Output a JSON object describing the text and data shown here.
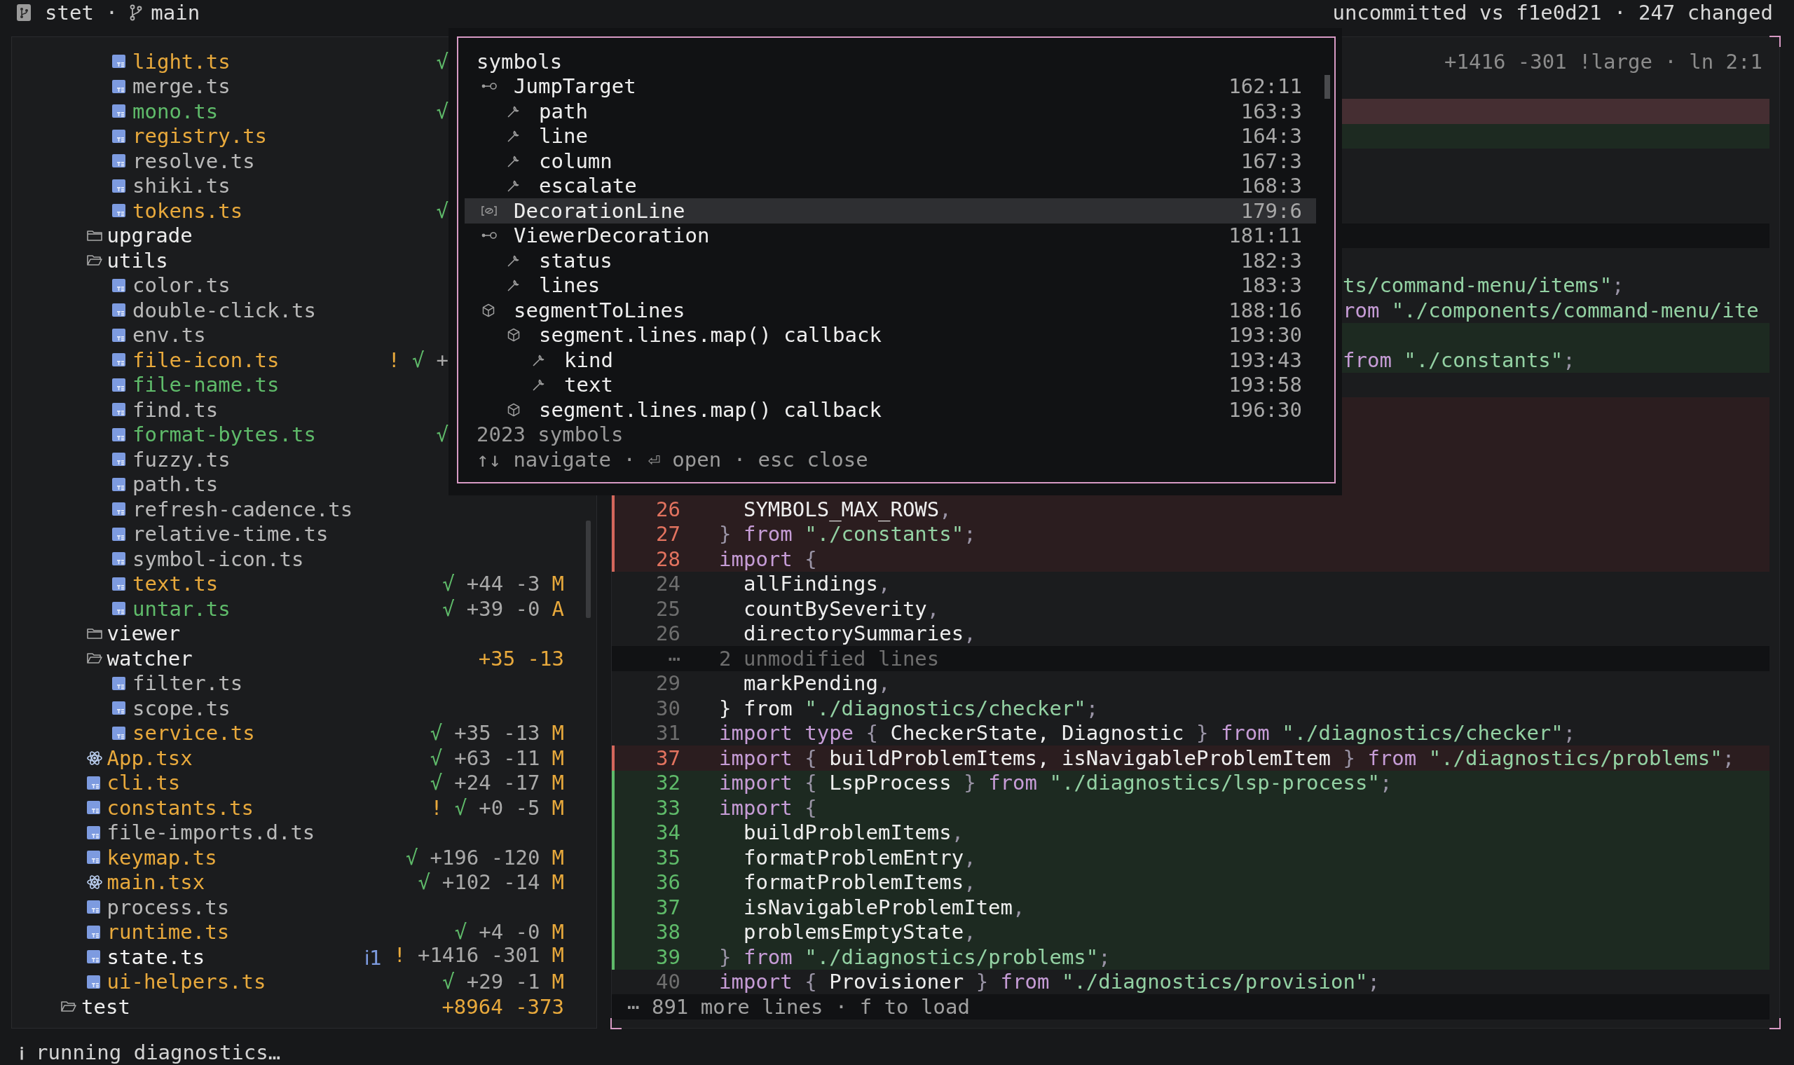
{
  "top_bar": {
    "repo": "stet",
    "separator": "·",
    "branch": "main",
    "summary": "uncommitted vs f1e0d21 · 247 changed"
  },
  "tree": {
    "items": [
      {
        "children": [
          {
            "children": [
              {
                "kind": "ts-file",
                "name": "light.ts",
                "modified": true,
                "added": false,
                "selected": false,
                "status": [
                  {
                    "kind": "ok",
                    "text": "√"
                  }
                ]
              },
              {
                "kind": "ts-file",
                "name": "merge.ts",
                "modified": false,
                "added": false,
                "selected": false
              },
              {
                "kind": "ts-file",
                "name": "mono.ts",
                "modified": false,
                "added": true,
                "selected": false,
                "status": [
                  {
                    "kind": "ok",
                    "text": "√"
                  }
                ]
              },
              {
                "kind": "ts-file",
                "name": "registry.ts",
                "modified": true,
                "added": false,
                "selected": false
              },
              {
                "kind": "ts-file",
                "name": "resolve.ts",
                "modified": false,
                "added": false,
                "selected": false
              },
              {
                "kind": "ts-file",
                "name": "shiki.ts",
                "modified": false,
                "added": false,
                "selected": false
              },
              {
                "kind": "ts-file",
                "name": "tokens.ts",
                "modified": true,
                "added": false,
                "selected": false,
                "status": [
                  {
                    "kind": "ok",
                    "text": "√"
                  }
                ]
              }
            ]
          },
          {
            "kind": "folder",
            "name": "upgrade",
            "expanded": false
          },
          {
            "kind": "folder",
            "name": "utils",
            "expanded": true,
            "children": [
              {
                "kind": "ts-file",
                "name": "color.ts",
                "modified": false,
                "added": false,
                "selected": false
              },
              {
                "kind": "ts-file",
                "name": "double-click.ts",
                "modified": false,
                "added": false,
                "selected": false
              },
              {
                "kind": "ts-file",
                "name": "env.ts",
                "modified": false,
                "added": false,
                "selected": false
              },
              {
                "kind": "ts-file",
                "name": "file-icon.ts",
                "modified": true,
                "added": false,
                "selected": false,
                "status": [
                  {
                    "kind": "warn",
                    "text": "!"
                  },
                  {
                    "kind": "ok",
                    "text": "√"
                  },
                  {
                    "kind": "stat",
                    "text": "+"
                  }
                ]
              },
              {
                "kind": "ts-file",
                "name": "file-name.ts",
                "modified": false,
                "added": true,
                "selected": false
              },
              {
                "kind": "ts-file",
                "name": "find.ts",
                "modified": false,
                "added": false,
                "selected": false
              },
              {
                "kind": "ts-file",
                "name": "format-bytes.ts",
                "modified": false,
                "added": true,
                "selected": false,
                "status": [
                  {
                    "kind": "ok",
                    "text": "√"
                  }
                ]
              },
              {
                "kind": "ts-file",
                "name": "fuzzy.ts",
                "modified": false,
                "added": false,
                "selected": false
              },
              {
                "kind": "ts-file",
                "name": "path.ts",
                "modified": false,
                "added": false,
                "selected": false
              },
              {
                "kind": "ts-file",
                "name": "refresh-cadence.ts",
                "modified": false,
                "added": false,
                "selected": false
              },
              {
                "kind": "ts-file",
                "name": "relative-time.ts",
                "modified": false,
                "added": false,
                "selected": false
              },
              {
                "kind": "ts-file",
                "name": "symbol-icon.ts",
                "modified": false,
                "added": false,
                "selected": false
              },
              {
                "kind": "ts-file",
                "name": "text.ts",
                "modified": true,
                "added": false,
                "selected": false,
                "status": [
                  {
                    "kind": "ok",
                    "text": "√"
                  },
                  {
                    "kind": "stat",
                    "text": "+44 -3"
                  },
                  {
                    "kind": "letter",
                    "text": "M"
                  }
                ]
              },
              {
                "kind": "ts-file",
                "name": "untar.ts",
                "modified": false,
                "added": true,
                "selected": false,
                "status": [
                  {
                    "kind": "ok",
                    "text": "√"
                  },
                  {
                    "kind": "stat",
                    "text": "+39 -0"
                  },
                  {
                    "kind": "letter",
                    "text": "A"
                  }
                ]
              }
            ]
          },
          {
            "kind": "folder",
            "name": "viewer",
            "expanded": false
          },
          {
            "kind": "folder",
            "name": "watcher",
            "expanded": true,
            "status": [
              {
                "kind": "total",
                "text": "+35 -13"
              }
            ],
            "children": [
              {
                "kind": "ts-file",
                "name": "filter.ts",
                "modified": false,
                "added": false,
                "selected": false
              },
              {
                "kind": "ts-file",
                "name": "scope.ts",
                "modified": false,
                "added": false,
                "selected": false
              },
              {
                "kind": "ts-file",
                "name": "service.ts",
                "modified": true,
                "added": false,
                "selected": false,
                "status": [
                  {
                    "kind": "ok",
                    "text": "√"
                  },
                  {
                    "kind": "stat",
                    "text": "+35 -13"
                  },
                  {
                    "kind": "letter",
                    "text": "M"
                  }
                ]
              }
            ]
          },
          {
            "kind": "tsx-file",
            "name": "App.tsx",
            "modified": true,
            "added": false,
            "selected": false,
            "status": [
              {
                "kind": "ok",
                "text": "√"
              },
              {
                "kind": "stat",
                "text": "+63 -11"
              },
              {
                "kind": "letter",
                "text": "M"
              }
            ]
          },
          {
            "kind": "ts-file",
            "name": "cli.ts",
            "modified": true,
            "added": false,
            "selected": false,
            "status": [
              {
                "kind": "ok",
                "text": "√"
              },
              {
                "kind": "stat",
                "text": "+24 -17"
              },
              {
                "kind": "letter",
                "text": "M"
              }
            ]
          },
          {
            "kind": "ts-file",
            "name": "constants.ts",
            "modified": true,
            "added": false,
            "selected": false,
            "status": [
              {
                "kind": "warn",
                "text": "!"
              },
              {
                "kind": "ok",
                "text": "√"
              },
              {
                "kind": "stat",
                "text": "+0 -5"
              },
              {
                "kind": "letter",
                "text": "M"
              }
            ]
          },
          {
            "kind": "ts-file",
            "name": "file-imports.d.ts",
            "modified": false,
            "added": false,
            "selected": false
          },
          {
            "kind": "ts-file",
            "name": "keymap.ts",
            "modified": true,
            "added": false,
            "selected": false,
            "status": [
              {
                "kind": "ok",
                "text": "√"
              },
              {
                "kind": "stat",
                "text": "+196 -120"
              },
              {
                "kind": "letter",
                "text": "M"
              }
            ]
          },
          {
            "kind": "tsx-file",
            "name": "main.tsx",
            "modified": true,
            "added": false,
            "selected": false,
            "status": [
              {
                "kind": "ok",
                "text": "√"
              },
              {
                "kind": "stat",
                "text": "+102 -14"
              },
              {
                "kind": "letter",
                "text": "M"
              }
            ]
          },
          {
            "kind": "ts-file",
            "name": "process.ts",
            "modified": false,
            "added": false,
            "selected": false
          },
          {
            "kind": "ts-file",
            "name": "runtime.ts",
            "modified": true,
            "added": false,
            "selected": false,
            "status": [
              {
                "kind": "ok",
                "text": "√"
              },
              {
                "kind": "stat",
                "text": "+4 -0"
              },
              {
                "kind": "letter",
                "text": "M"
              }
            ]
          },
          {
            "kind": "ts-file",
            "name": "state.ts",
            "modified": true,
            "added": false,
            "selected": true,
            "status": [
              {
                "kind": "info",
                "text": "ℹ1"
              },
              {
                "kind": "warn",
                "text": "!"
              },
              {
                "kind": "stat",
                "text": "+1416 -301"
              },
              {
                "kind": "letter",
                "text": "M"
              }
            ]
          },
          {
            "kind": "ts-file",
            "name": "ui-helpers.ts",
            "modified": true,
            "added": false,
            "selected": false,
            "status": [
              {
                "kind": "ok",
                "text": "√"
              },
              {
                "kind": "stat",
                "text": "+29 -1"
              },
              {
                "kind": "letter",
                "text": "M"
              }
            ]
          }
        ]
      },
      {
        "kind": "folder",
        "name": "test",
        "expanded": true,
        "status": [
          {
            "kind": "total",
            "text": "+8964 -373"
          }
        ]
      }
    ]
  },
  "diff": {
    "header": "+1416 -301 !large · ln 2:1",
    "rows": [
      {
        "kind": "ctx",
        "selected": false
      },
      {
        "kind": "del",
        "selected": true
      },
      {
        "kind": "add",
        "selected": false
      },
      {
        "kind": "ctx",
        "selected": false
      },
      {
        "kind": "ctx",
        "selected": false
      },
      {
        "kind": "ctx",
        "selected": false
      },
      {
        "kind": "fold",
        "selected": false
      },
      {
        "kind": "ctx",
        "selected": false
      },
      {
        "kind": "ctx",
        "selected": false,
        "tokens": [
          {
            "kind": "str",
            "text": "ts/command-menu/items\""
          },
          {
            "kind": "p",
            "text": ";"
          }
        ]
      },
      {
        "kind": "ctx",
        "selected": false,
        "tokens": [
          {
            "kind": "kw",
            "text": "rom "
          },
          {
            "kind": "str",
            "text": "\"./components/command-menu/ite"
          }
        ]
      },
      {
        "kind": "add",
        "selected": false
      },
      {
        "kind": "add",
        "selected": false,
        "tokens": [
          {
            "kind": "kw",
            "text": "from "
          },
          {
            "kind": "str",
            "text": "\"./constants\""
          },
          {
            "kind": "p",
            "text": ";"
          }
        ]
      },
      {
        "kind": "ctx",
        "selected": false
      },
      {
        "kind": "del",
        "selected": false
      },
      {
        "kind": "del",
        "selected": false
      },
      {
        "kind": "del",
        "selected": false
      },
      {
        "kind": "del",
        "selected": false
      },
      {
        "kind": "del",
        "selected": false,
        "num": "26",
        "tokens": [
          {
            "kind": "id",
            "text": "  SYMBOLS_MAX_ROWS"
          },
          {
            "kind": "p",
            "text": ","
          }
        ]
      },
      {
        "kind": "del",
        "selected": false,
        "num": "27",
        "tokens": [
          {
            "kind": "p",
            "text": "} "
          },
          {
            "kind": "kw",
            "text": "from "
          },
          {
            "kind": "str",
            "text": "\"./constants\""
          },
          {
            "kind": "p",
            "text": ";"
          }
        ]
      },
      {
        "kind": "del",
        "selected": false,
        "num": "28",
        "tokens": [
          {
            "kind": "kw",
            "text": "import"
          },
          {
            "kind": "p",
            "text": " {"
          }
        ]
      },
      {
        "kind": "ctx",
        "selected": false,
        "num": "24",
        "tokens": [
          {
            "kind": "id",
            "text": "  allFindings"
          },
          {
            "kind": "p",
            "text": ","
          }
        ]
      },
      {
        "kind": "ctx",
        "selected": false,
        "num": "25",
        "tokens": [
          {
            "kind": "id",
            "text": "  countBySeverity"
          },
          {
            "kind": "p",
            "text": ","
          }
        ]
      },
      {
        "kind": "ctx",
        "selected": false,
        "num": "26",
        "tokens": [
          {
            "kind": "id",
            "text": "  directorySummaries"
          },
          {
            "kind": "p",
            "text": ","
          }
        ]
      },
      {
        "kind": "fold",
        "selected": false,
        "num": "⋯",
        "label": "2 unmodified lines"
      },
      {
        "kind": "ctx",
        "selected": false,
        "num": "29",
        "tokens": [
          {
            "kind": "id",
            "text": "  markPending"
          },
          {
            "kind": "p",
            "text": ","
          }
        ]
      },
      {
        "kind": "ctx",
        "selected": false,
        "num": "30",
        "tokens": [
          {
            "kind": "id",
            "text": "} from "
          },
          {
            "kind": "str",
            "text": "\"./diagnostics/checker\""
          },
          {
            "kind": "p",
            "text": ";"
          }
        ]
      },
      {
        "kind": "ctx",
        "selected": false,
        "num": "31",
        "tokens": [
          {
            "kind": "kw",
            "text": "import type"
          },
          {
            "kind": "p",
            "text": " { "
          },
          {
            "kind": "id",
            "text": "CheckerState, Diagnostic"
          },
          {
            "kind": "p",
            "text": " } "
          },
          {
            "kind": "kw",
            "text": "from "
          },
          {
            "kind": "str",
            "text": "\"./diagnostics/checker\""
          },
          {
            "kind": "p",
            "text": ";"
          }
        ]
      },
      {
        "kind": "del",
        "selected": false,
        "num": "37",
        "tokens": [
          {
            "kind": "kw",
            "text": "import"
          },
          {
            "kind": "p",
            "text": " { "
          },
          {
            "kind": "id",
            "text": "buildProblemItems, isNavigableProblemItem"
          },
          {
            "kind": "p",
            "text": " } "
          },
          {
            "kind": "kw",
            "text": "from "
          },
          {
            "kind": "str",
            "text": "\"./diagnostics/problems\""
          },
          {
            "kind": "p",
            "text": ";"
          }
        ]
      },
      {
        "kind": "add",
        "selected": false,
        "num": "32",
        "tokens": [
          {
            "kind": "kw",
            "text": "import"
          },
          {
            "kind": "p",
            "text": " { "
          },
          {
            "kind": "id",
            "text": "LspProcess"
          },
          {
            "kind": "p",
            "text": " } "
          },
          {
            "kind": "kw",
            "text": "from "
          },
          {
            "kind": "str",
            "text": "\"./diagnostics/lsp-process\""
          },
          {
            "kind": "p",
            "text": ";"
          }
        ]
      },
      {
        "kind": "add",
        "selected": false,
        "num": "33",
        "tokens": [
          {
            "kind": "kw",
            "text": "import"
          },
          {
            "kind": "p",
            "text": " {"
          }
        ]
      },
      {
        "kind": "add",
        "selected": false,
        "num": "34",
        "tokens": [
          {
            "kind": "id",
            "text": "  buildProblemItems"
          },
          {
            "kind": "p",
            "text": ","
          }
        ]
      },
      {
        "kind": "add",
        "selected": false,
        "num": "35",
        "tokens": [
          {
            "kind": "id",
            "text": "  formatProblemEntry"
          },
          {
            "kind": "p",
            "text": ","
          }
        ]
      },
      {
        "kind": "add",
        "selected": false,
        "num": "36",
        "tokens": [
          {
            "kind": "id",
            "text": "  formatProblemItems"
          },
          {
            "kind": "p",
            "text": ","
          }
        ]
      },
      {
        "kind": "add",
        "selected": false,
        "num": "37",
        "tokens": [
          {
            "kind": "id",
            "text": "  isNavigableProblemItem"
          },
          {
            "kind": "p",
            "text": ","
          }
        ]
      },
      {
        "kind": "add",
        "selected": false,
        "num": "38",
        "tokens": [
          {
            "kind": "id",
            "text": "  problemsEmptyState"
          },
          {
            "kind": "p",
            "text": ","
          }
        ]
      },
      {
        "kind": "add",
        "selected": false,
        "num": "39",
        "tokens": [
          {
            "kind": "p",
            "text": "} "
          },
          {
            "kind": "kw",
            "text": "from "
          },
          {
            "kind": "str",
            "text": "\"./diagnostics/problems\""
          },
          {
            "kind": "p",
            "text": ";"
          }
        ]
      },
      {
        "kind": "ctx",
        "selected": false,
        "num": "40",
        "tokens": [
          {
            "kind": "kw",
            "text": "import"
          },
          {
            "kind": "p",
            "text": " { "
          },
          {
            "kind": "id",
            "text": "Provisioner"
          },
          {
            "kind": "p",
            "text": " } "
          },
          {
            "kind": "kw",
            "text": "from "
          },
          {
            "kind": "str",
            "text": "\"./diagnostics/provision\""
          },
          {
            "kind": "p",
            "text": ";"
          }
        ]
      },
      {
        "kind": "more",
        "selected": false,
        "label": "⋯ 891 more lines · f to load"
      }
    ]
  },
  "symbols_popup": {
    "title": "symbols",
    "items": [
      {
        "kind": "interface",
        "name": "JumpTarget",
        "pos": "162:11",
        "selected": false,
        "children": [
          {
            "kind": "property",
            "name": "path",
            "pos": "163:3",
            "selected": false
          },
          {
            "kind": "property",
            "name": "line",
            "pos": "164:3",
            "selected": false
          },
          {
            "kind": "property",
            "name": "column",
            "pos": "167:3",
            "selected": false
          },
          {
            "kind": "property",
            "name": "escalate",
            "pos": "168:3",
            "selected": false
          }
        ]
      },
      {
        "kind": "type",
        "name": "DecorationLine",
        "pos": "179:6",
        "selected": true
      },
      {
        "kind": "interface",
        "name": "ViewerDecoration",
        "pos": "181:11",
        "selected": false,
        "children": [
          {
            "kind": "property",
            "name": "status",
            "pos": "182:3",
            "selected": false
          },
          {
            "kind": "property",
            "name": "lines",
            "pos": "183:3",
            "selected": false
          }
        ]
      },
      {
        "kind": "function",
        "name": "segmentToLines",
        "pos": "188:16",
        "selected": false,
        "children": [
          {
            "kind": "function",
            "name": "segment.lines.map() callback",
            "pos": "193:30",
            "selected": false,
            "children": [
              {
                "kind": "property",
                "name": "kind",
                "pos": "193:43",
                "selected": false
              },
              {
                "kind": "property",
                "name": "text",
                "pos": "193:58",
                "selected": false
              }
            ]
          },
          {
            "kind": "function",
            "name": "segment.lines.map() callback",
            "pos": "196:30",
            "selected": false
          }
        ]
      }
    ],
    "count": "2023 symbols",
    "hint": "↑↓ navigate · ⏎ open · esc close"
  },
  "status_bar": {
    "icon": "ℹ",
    "message": "running diagnostics…"
  }
}
